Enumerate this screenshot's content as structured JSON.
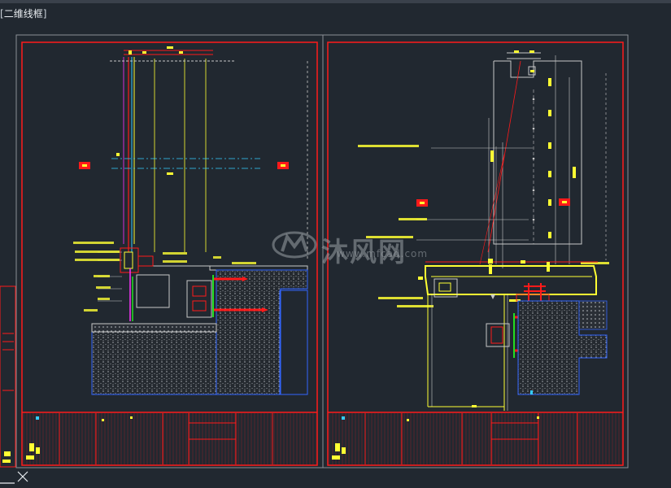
{
  "viewport": {
    "label_open": "[",
    "label_text": "二维线框",
    "label_close": "]"
  },
  "watermark": {
    "text": "沐风网",
    "url": "www.mfcad.com"
  },
  "drawing": {
    "layout_count": 2,
    "colors": {
      "background": "#212830",
      "frame": "#ff1a1a",
      "sheet_border": "#8a8f96",
      "yellow": "#ffff33",
      "green": "#22dd22",
      "cyan": "#33ccff",
      "magenta": "#ff33ff",
      "hatch": "#9aa0a6",
      "dim": "#c8c8c8"
    }
  },
  "ucs_icon": "ucs-axis-icon"
}
